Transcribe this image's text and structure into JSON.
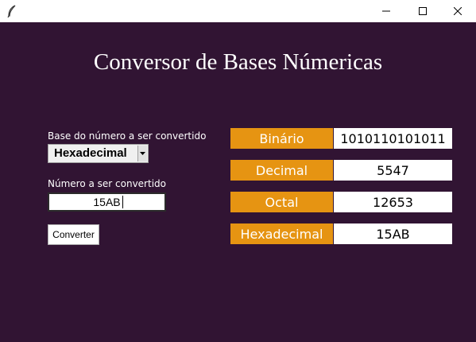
{
  "window": {
    "title": "",
    "icon": "feather-icon",
    "controls": [
      "minimize-icon",
      "maximize-icon",
      "close-icon"
    ]
  },
  "app": {
    "heading": "Conversor de Bases Númericas"
  },
  "form": {
    "base_label": "Base do número a ser convertido",
    "base_selected": "Hexadecimal",
    "number_label": "Número a ser convertido",
    "number_value": "15AB",
    "convert_button": "Converter"
  },
  "results": [
    {
      "label": "Binário",
      "value": "1010110101011"
    },
    {
      "label": "Decimal",
      "value": "5547"
    },
    {
      "label": "Octal",
      "value": "12653"
    },
    {
      "label": "Hexadecimal",
      "value": "15AB"
    }
  ],
  "colors": {
    "background": "#311433",
    "label_accent": "#e69412",
    "heading_text": "#ffffff",
    "value_bg": "#ffffff"
  }
}
